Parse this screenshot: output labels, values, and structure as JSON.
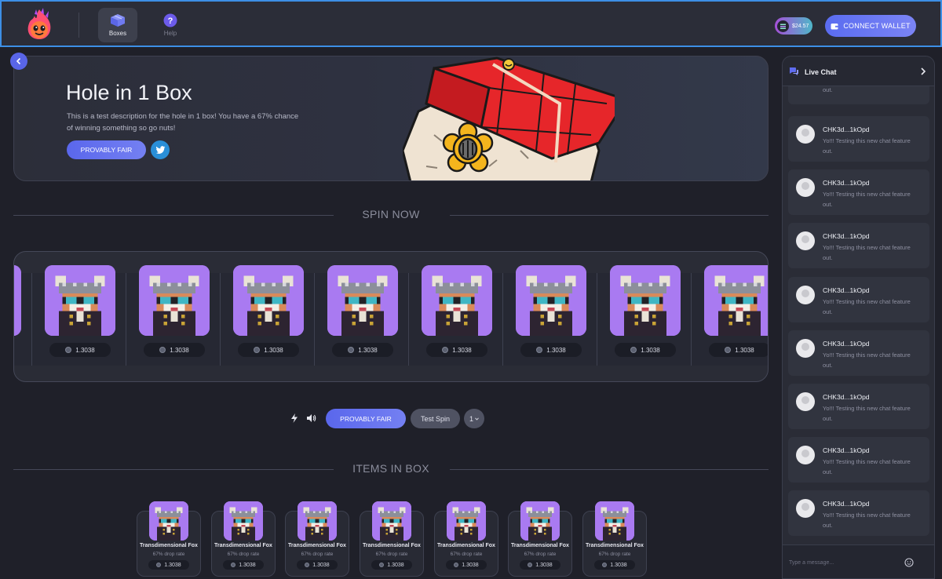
{
  "nav": {
    "boxes_label": "Boxes",
    "help_label": "Help",
    "balance": "$24.57",
    "connect_label": "CONNECT WALLET"
  },
  "hero": {
    "title": "Hole in 1 Box",
    "description": "This is a test description for the hole in 1 box! You have a 67% chance of winning something so go nuts!",
    "provably_fair_label": "PROVABLY FAIR"
  },
  "spin": {
    "section_title": "SPIN NOW",
    "items": [
      {
        "value": "1.3038"
      },
      {
        "value": "1.3038"
      },
      {
        "value": "1.3038"
      },
      {
        "value": "1.3038"
      },
      {
        "value": "1.3038"
      },
      {
        "value": "1.3038"
      },
      {
        "value": "1.3038"
      },
      {
        "value": "1.3038"
      }
    ]
  },
  "controls": {
    "provably_fair_label": "PROVABLY FAIR",
    "test_spin_label": "Test Spin",
    "quantity": "1"
  },
  "items_section": {
    "section_title": "ITEMS IN BOX",
    "items": [
      {
        "name": "Transdimensional Fox",
        "rate": "67% drop rate",
        "value": "1.3038"
      },
      {
        "name": "Transdimensional Fox",
        "rate": "67% drop rate",
        "value": "1.3038"
      },
      {
        "name": "Transdimensional Fox",
        "rate": "67% drop rate",
        "value": "1.3038"
      },
      {
        "name": "Transdimensional Fox",
        "rate": "67% drop rate",
        "value": "1.3038"
      },
      {
        "name": "Transdimensional Fox",
        "rate": "67% drop rate",
        "value": "1.3038"
      },
      {
        "name": "Transdimensional Fox",
        "rate": "67% drop rate",
        "value": "1.3038"
      },
      {
        "name": "Transdimensional Fox",
        "rate": "67% drop rate",
        "value": "1.3038"
      }
    ]
  },
  "chat": {
    "title": "Live Chat",
    "partial_top_text": "Yo!!! Testing this new chat feature out.",
    "messages": [
      {
        "user": "CHK3d...1kOpd",
        "text": "Yo!!! Testing this new chat feature out."
      },
      {
        "user": "CHK3d...1kOpd",
        "text": "Yo!!! Testing this new chat feature out."
      },
      {
        "user": "CHK3d...1kOpd",
        "text": "Yo!!! Testing this new chat feature out."
      },
      {
        "user": "CHK3d...1kOpd",
        "text": "Yo!!! Testing this new chat feature out."
      },
      {
        "user": "CHK3d...1kOpd",
        "text": "Yo!!! Testing this new chat feature out."
      },
      {
        "user": "CHK3d...1kOpd",
        "text": "Yo!!! Testing this new chat feature out."
      },
      {
        "user": "CHK3d...1kOpd",
        "text": "Yo!!! Testing this new chat feature out."
      },
      {
        "user": "CHK3d...1kOpd",
        "text": "Yo!!! Testing this new chat feature out."
      }
    ],
    "input_placeholder": "Type a message..."
  },
  "icons": {
    "logo": "flame-mascot-icon",
    "boxes": "box-icon",
    "help": "help-icon",
    "back": "chevron-left-icon",
    "twitter": "twitter-icon",
    "lightning": "lightning-icon",
    "sound": "speaker-icon",
    "chat": "chat-bubbles-icon",
    "chat_toggle": "chevron-right-icon",
    "emoji": "emoji-icon",
    "wallet": "wallet-icon",
    "coin": "coin-icon"
  },
  "colors": {
    "accent": "#5a67ec",
    "item_background": "#a97af1",
    "topbar_border": "#3d8fe6"
  }
}
